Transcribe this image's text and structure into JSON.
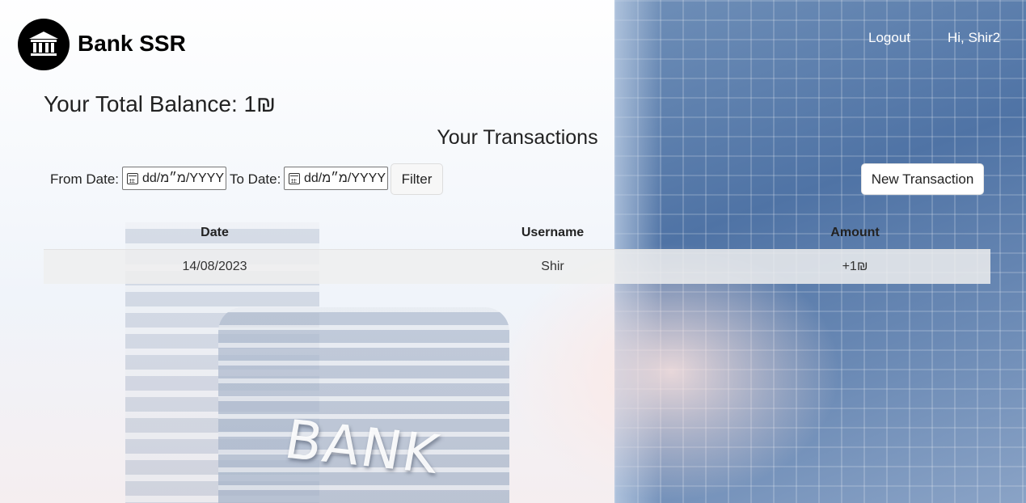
{
  "header": {
    "brand": "Bank SSR",
    "logout_label": "Logout",
    "greeting": "Hi, Shir2"
  },
  "balance_text": "Your Total Balance: 1₪",
  "transactions_title": "Your Transactions",
  "filters": {
    "from_label": "From Date:",
    "from_value": "dd/מ״מ/YYYY",
    "to_label": "To Date:",
    "to_value": "dd/מ״מ/YYYY",
    "filter_button": "Filter"
  },
  "new_transaction_button": "New Transaction",
  "table": {
    "columns": [
      "Date",
      "Username",
      "Amount"
    ],
    "rows": [
      [
        "14/08/2023",
        "Shir",
        "+1₪"
      ]
    ]
  },
  "background": {
    "sign_text": "BANK"
  }
}
